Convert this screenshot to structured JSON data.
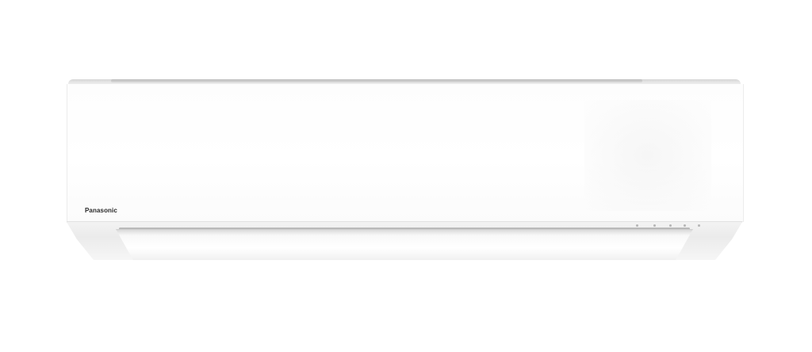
{
  "brand": {
    "logo_text": "Panasonic"
  },
  "colors": {
    "background": "#ffffff",
    "panel": "#ffffff",
    "housing": "#ebebeb",
    "logo": "#2a2a2a"
  }
}
